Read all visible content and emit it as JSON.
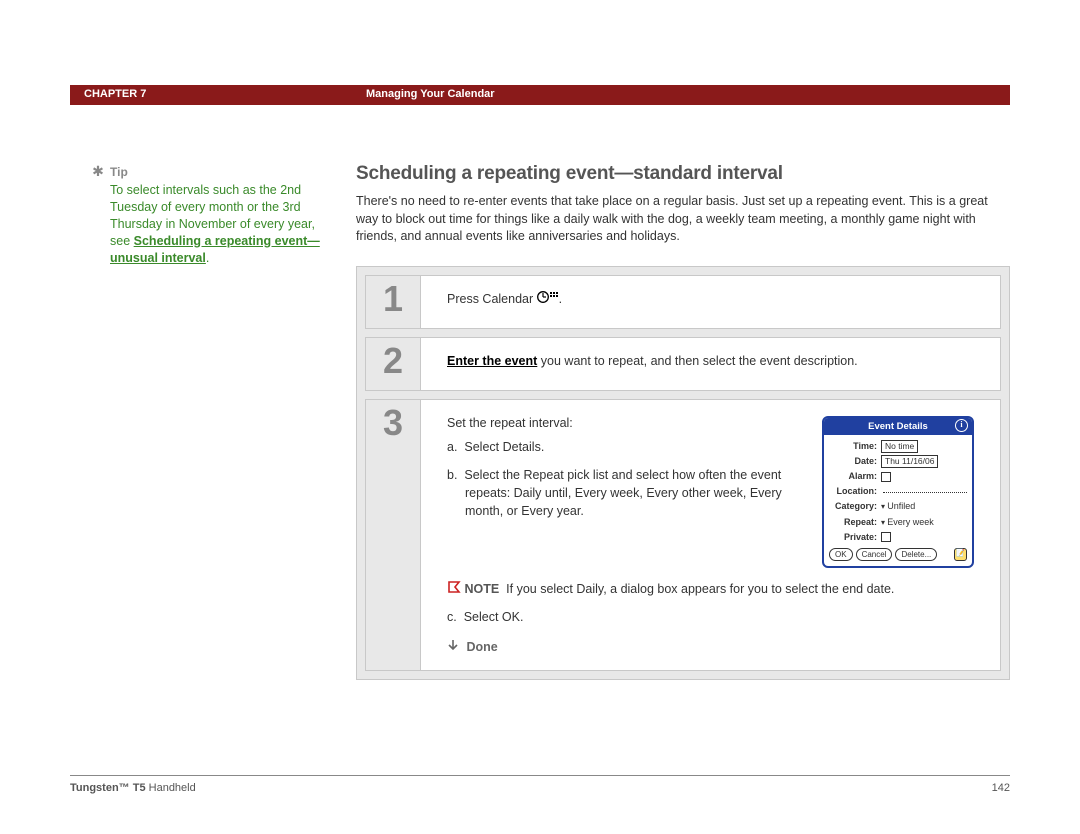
{
  "header": {
    "chapter": "CHAPTER 7",
    "title": "Managing Your Calendar"
  },
  "sidebar": {
    "tip_label": "Tip",
    "tip_text_1": "To select intervals such as the 2nd Tuesday of every month or the 3rd Thursday in November of every year, see ",
    "tip_link": "Scheduling a repeating event—unusual interval",
    "tip_text_2": "."
  },
  "main": {
    "heading": "Scheduling a repeating event—standard interval",
    "intro": "There's no need to re-enter events that take place on a regular basis. Just set up a repeating event. This is a great way to block out time for things like a daily walk with the dog, a weekly team meeting, a monthly game night with friends, and annual events like anniversaries and holidays."
  },
  "steps": {
    "s1": {
      "num": "1",
      "text_a": "Press Calendar ",
      "text_b": "."
    },
    "s2": {
      "num": "2",
      "link": "Enter the event",
      "text": " you want to repeat, and then select the event description."
    },
    "s3": {
      "num": "3",
      "lead": "Set the repeat interval:",
      "a_label": "a.",
      "a_text": "Select Details.",
      "b_label": "b.",
      "b_text": "Select the Repeat pick list and select how often the event repeats: Daily until, Every week, Every other week, Every month, or Every year.",
      "note_label": "NOTE",
      "note_text": "If you select Daily, a dialog box appears for you to select the end date.",
      "c_label": "c.",
      "c_text": "Select OK.",
      "done": "Done"
    }
  },
  "pda": {
    "title": "Event Details",
    "time_lbl": "Time:",
    "time_val": "No time",
    "date_lbl": "Date:",
    "date_val": "Thu 11/16/06",
    "alarm_lbl": "Alarm:",
    "location_lbl": "Location:",
    "category_lbl": "Category:",
    "category_val": "Unfiled",
    "repeat_lbl": "Repeat:",
    "repeat_val": "Every week",
    "private_lbl": "Private:",
    "ok": "OK",
    "cancel": "Cancel",
    "delete": "Delete..."
  },
  "footer": {
    "product_bold": "Tungsten™ T5",
    "product_rest": " Handheld",
    "page": "142"
  }
}
